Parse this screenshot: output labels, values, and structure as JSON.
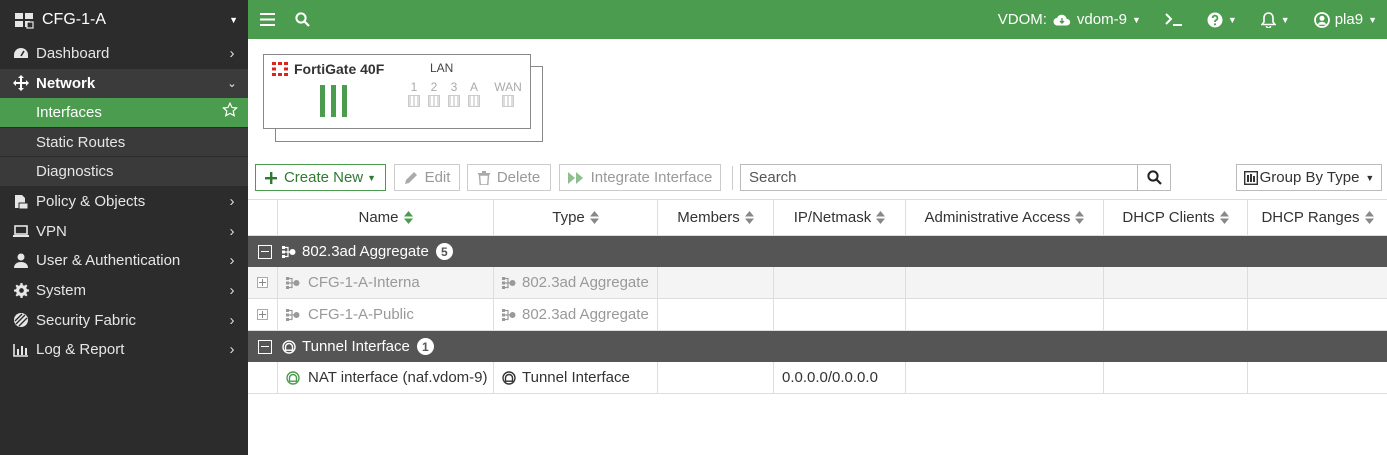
{
  "app": {
    "title": "CFG-1-A"
  },
  "sidebar": {
    "items": [
      {
        "label": "Dashboard",
        "icon": "dashboard-icon"
      },
      {
        "label": "Network",
        "icon": "network-icon",
        "open": true,
        "children": [
          {
            "label": "Interfaces",
            "active": true
          },
          {
            "label": "Static Routes"
          },
          {
            "label": "Diagnostics"
          }
        ]
      },
      {
        "label": "Policy & Objects",
        "icon": "policy-icon"
      },
      {
        "label": "VPN",
        "icon": "vpn-icon"
      },
      {
        "label": "User & Authentication",
        "icon": "user-icon"
      },
      {
        "label": "System",
        "icon": "gear-icon"
      },
      {
        "label": "Security Fabric",
        "icon": "fabric-icon"
      },
      {
        "label": "Log & Report",
        "icon": "log-icon"
      }
    ]
  },
  "topbar": {
    "vdom_label": "VDOM:",
    "vdom_value": "vdom-9",
    "user": "pla9"
  },
  "device": {
    "name": "FortiGate 40F",
    "lan_label": "LAN",
    "ports": [
      "1",
      "2",
      "3",
      "A"
    ],
    "wan_label": "WAN"
  },
  "toolbar": {
    "create_new": "Create New",
    "edit": "Edit",
    "delete": "Delete",
    "integrate": "Integrate Interface",
    "search_placeholder": "Search",
    "group_by": "Group By Type"
  },
  "table": {
    "columns": [
      "Name",
      "Type",
      "Members",
      "IP/Netmask",
      "Administrative Access",
      "DHCP Clients",
      "DHCP Ranges"
    ],
    "groups": [
      {
        "label": "802.3ad Aggregate",
        "count": "5",
        "rows": [
          {
            "name": "CFG-1-A-Interna",
            "type": "802.3ad Aggregate",
            "members": "",
            "ip": "",
            "access": "",
            "clients": "",
            "ranges": ""
          },
          {
            "name": "CFG-1-A-Public",
            "type": "802.3ad Aggregate",
            "members": "",
            "ip": "",
            "access": "",
            "clients": "",
            "ranges": ""
          }
        ]
      },
      {
        "label": "Tunnel Interface",
        "count": "1",
        "rows": [
          {
            "name": "NAT interface (naf.vdom-9)",
            "type": "Tunnel Interface",
            "members": "",
            "ip": "0.0.0.0/0.0.0.0",
            "access": "",
            "clients": "",
            "ranges": ""
          }
        ]
      }
    ]
  },
  "colors": {
    "accent": "#4b9c4e",
    "sidebar": "#2c2c2c",
    "group_row": "#555555"
  }
}
